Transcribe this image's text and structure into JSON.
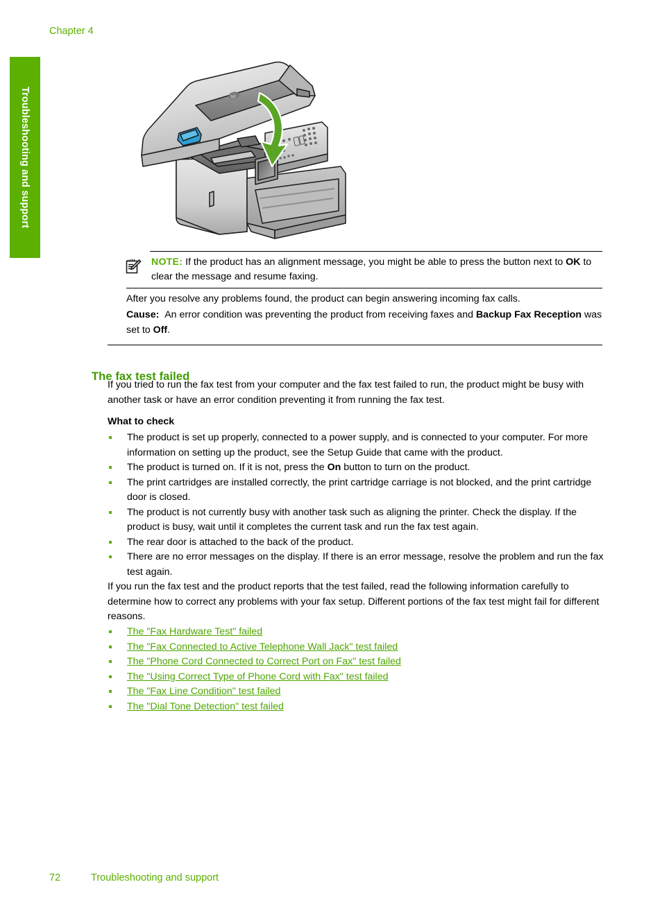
{
  "page": {
    "chapter_label": "Chapter 4",
    "side_tab_label": "Troubleshooting and support",
    "footer_page_number": "72",
    "footer_title": "Troubleshooting and support",
    "accent_green": "#5bb000",
    "heading_green": "#3d9b00",
    "link_green": "#4da500",
    "arrow_green": "#5aa525"
  },
  "figure": {
    "name": "printer-lid-closing-illustration",
    "alt": "All-in-one printer with scanner lid open and green curved arrow indicating closing the lid",
    "brand_mark": "hp"
  },
  "note": {
    "icon": "note-pencil-icon",
    "label": "NOTE:",
    "text_part_1": "If the product has an alignment message, you might be able to press the button next to ",
    "bold_1": "OK",
    "text_part_2": " to clear the message and resume faxing."
  },
  "resolution": {
    "after_text": "After you resolve any problems found, the product can begin answering incoming fax calls.",
    "cause_label": "Cause:",
    "cause_text_1": "An error condition was preventing the product from receiving faxes and ",
    "cause_bold_1": "Backup Fax Reception",
    "cause_text_2": " was set to ",
    "cause_bold_2": "Off",
    "cause_text_3": "."
  },
  "section": {
    "heading": "The fax test failed",
    "intro": "If you tried to run the fax test from your computer and the fax test failed to run, the product might be busy with another task or have an error condition preventing it from running the fax test.",
    "sub_heading": "What to check",
    "checks": [
      {
        "text_1": "The product is set up properly, connected to a power supply, and is connected to your computer. For more information on setting up the product, see the Setup Guide that came with the product.",
        "bold": "",
        "text_2": ""
      },
      {
        "text_1": "The product is turned on. If it is not, press the ",
        "bold": "On",
        "text_2": " button to turn on the product."
      },
      {
        "text_1": "The print cartridges are installed correctly, the print cartridge carriage is not blocked, and the print cartridge door is closed.",
        "bold": "",
        "text_2": ""
      },
      {
        "text_1": "The product is not currently busy with another task such as aligning the printer. Check the display. If the product is busy, wait until it completes the current task and run the fax test again.",
        "bold": "",
        "text_2": ""
      },
      {
        "text_1": "The rear door is attached to the back of the product.",
        "bold": "",
        "text_2": ""
      },
      {
        "text_1": "There are no error messages on the display. If there is an error message, resolve the problem and run the fax test again.",
        "bold": "",
        "text_2": ""
      }
    ],
    "run_fax_paragraph": "If you run the fax test and the product reports that the test failed, read the following information carefully to determine how to correct any problems with your fax setup. Different portions of the fax test might fail for different reasons.",
    "links": [
      "The \"Fax Hardware Test\" failed",
      "The \"Fax Connected to Active Telephone Wall Jack\" test failed",
      "The \"Phone Cord Connected to Correct Port on Fax\" test failed",
      "The \"Using Correct Type of Phone Cord with Fax\" test failed",
      "The \"Fax Line Condition\" test failed",
      "The \"Dial Tone Detection\" test failed"
    ]
  }
}
